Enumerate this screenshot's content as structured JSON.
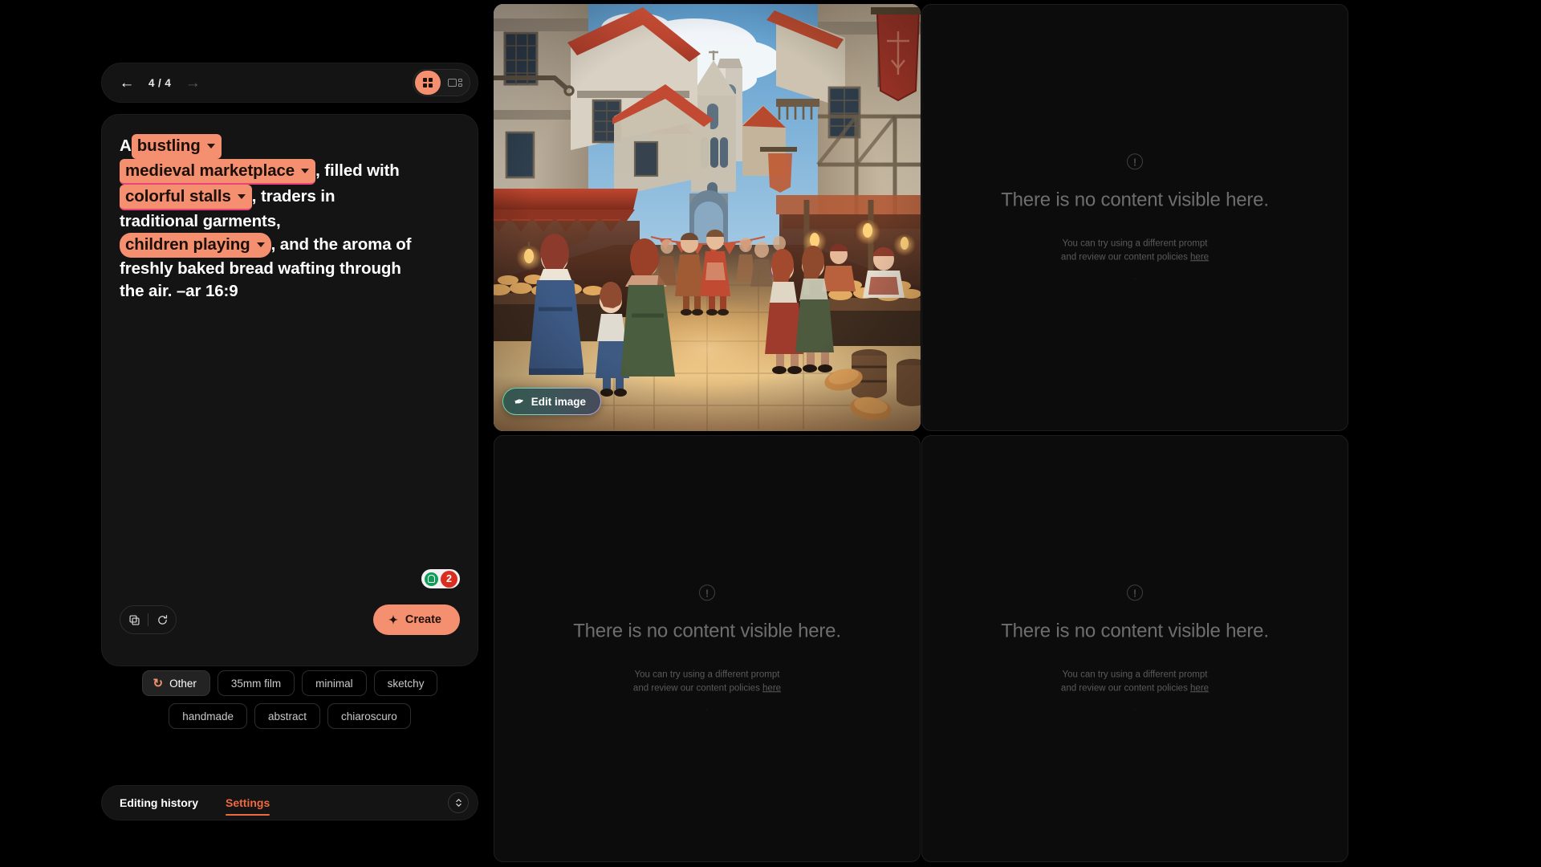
{
  "nav": {
    "back_icon": "arrow-left-icon",
    "forward_icon": "arrow-right-icon",
    "counter": "4 / 4",
    "view_grid_icon": "grid-view-icon",
    "view_split_icon": "split-view-icon"
  },
  "prompt": {
    "lead_text": "A",
    "chips": [
      {
        "label": "bustling",
        "caret": "chevron-down-icon"
      },
      {
        "label": "medieval marketplace",
        "caret": "chevron-down-icon"
      },
      {
        "label": "colorful stalls",
        "caret": "chevron-down-icon"
      },
      {
        "label": "children playing",
        "caret": "chevron-down-icon"
      }
    ],
    "seg_1": ", filled with",
    "seg_2": ", traders in",
    "seg_3": "traditional garments,",
    "seg_4": ", and the aroma of",
    "seg_5": "freshly baked bread wafting through",
    "seg_6": "the air. –ar 16:9",
    "spell_word": "with",
    "full_text": "A bustling medieval marketplace, filled with colorful stalls, traders in traditional garments, children playing, and the aroma of freshly baked bread wafting through the air. –ar 16:9",
    "hint_badge": {
      "icon": "lightbulb-icon",
      "count": "2"
    }
  },
  "actions": {
    "copy_icon": "copy-icon",
    "reset_icon": "reset-icon",
    "create_label": "Create",
    "create_icon": "sparkle-icon",
    "create_color": "#F4906F"
  },
  "styles": {
    "row1": [
      {
        "label": "Other",
        "active": true,
        "icon": "refresh-icon"
      },
      {
        "label": "35mm film",
        "active": false
      },
      {
        "label": "minimal",
        "active": false
      },
      {
        "label": "sketchy",
        "active": false
      }
    ],
    "row2": [
      {
        "label": "handmade",
        "active": false
      },
      {
        "label": "abstract",
        "active": false
      },
      {
        "label": "chiaroscuro",
        "active": false
      }
    ]
  },
  "tabs": {
    "items": [
      {
        "label": "Editing history",
        "active": false
      },
      {
        "label": "Settings",
        "active": true
      }
    ],
    "expand_icon": "expand-collapse-icon",
    "active_color": "#F06A3F"
  },
  "results": {
    "image_panel": {
      "alt": "medieval marketplace street scene with bread stalls and townsfolk",
      "edit_label": "Edit image",
      "edit_icon": "magic-wand-icon"
    },
    "empty_panels": [
      {
        "icon": "alert-circle-icon",
        "title": "There is no content visible here.",
        "sub_line1": "You can try using a different prompt",
        "sub_line2": "and review our content policies",
        "link": "here",
        "dot": "·"
      },
      {
        "icon": "alert-circle-icon",
        "title": "There is no content visible here.",
        "sub_line1": "You can try using a different prompt",
        "sub_line2": "and review our content policies",
        "link": "here",
        "dot": "·"
      },
      {
        "icon": "alert-circle-icon",
        "title": "There is no content visible here.",
        "sub_line1": "You can try using a different prompt",
        "sub_line2": "and review our content policies",
        "link": "here",
        "dot": "·"
      }
    ]
  },
  "theme": {
    "background": "#000000",
    "panel": "#141414",
    "accent": "#F4906F",
    "accent_strong": "#F06A3F",
    "chip_bg": "#F4906F",
    "spellcheck": "#E8447A",
    "badge_red": "#D92D20",
    "badge_green": "#0F9D58"
  }
}
